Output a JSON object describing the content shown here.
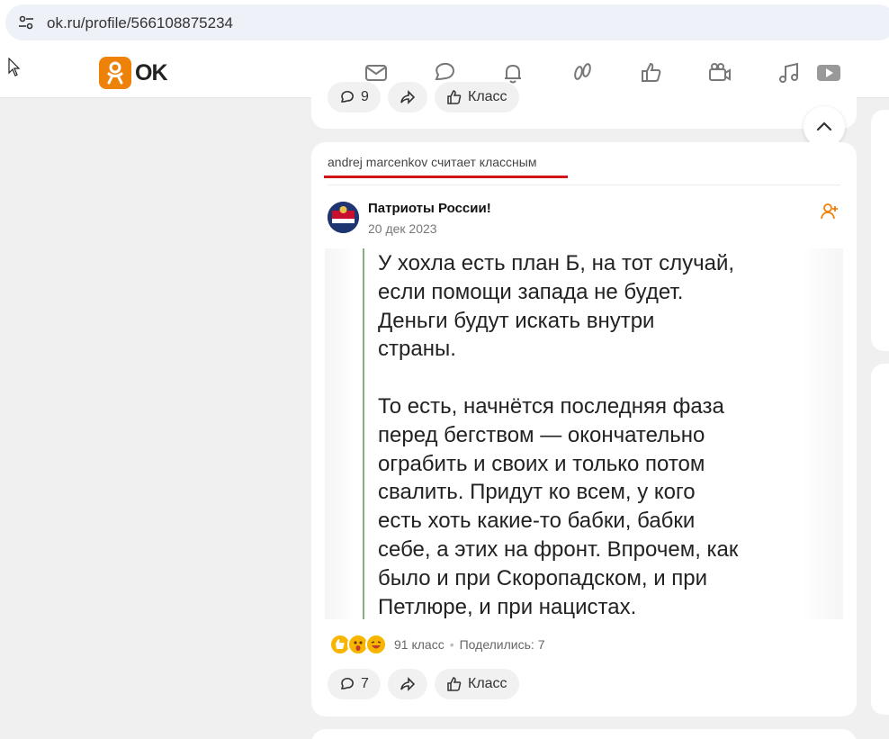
{
  "browser": {
    "url": "ok.ru/profile/566108875234"
  },
  "header": {
    "logo_text": "OK",
    "nav_icons": [
      "mail-icon",
      "chat-icon",
      "bell-icon",
      "guests-icon",
      "like-icon",
      "video-icon",
      "music-icon",
      "video-play-icon"
    ]
  },
  "prev_post": {
    "comments": "9",
    "like_label": "Класс"
  },
  "post": {
    "activity": {
      "user": "andrej marcenkov",
      "action": "считает классным"
    },
    "group_name": "Патриоты России!",
    "date": "20 дек 2023",
    "quote_text": "У хохла есть план Б, на тот случай,\nесли помощи запада не будет.\nДеньги будут искать внутри\nстраны.\n\nТо есть, начнётся последняя фаза\nперед бегством — окончательно\nограбить и своих и только потом\nсвалить. Придут ко всем, у кого\nесть хоть какие-то бабки, бабки\nсебе, а этих на фронт. Впрочем, как\nбыло и при Скоропадском, и при\nПетлюре, и при нацистах.",
    "likes": "91 класс",
    "shares": "Поделились: 7",
    "comments_count": "7",
    "like_label": "Класс"
  },
  "colors": {
    "brand": "#ee8208",
    "underline": "#d01418"
  }
}
